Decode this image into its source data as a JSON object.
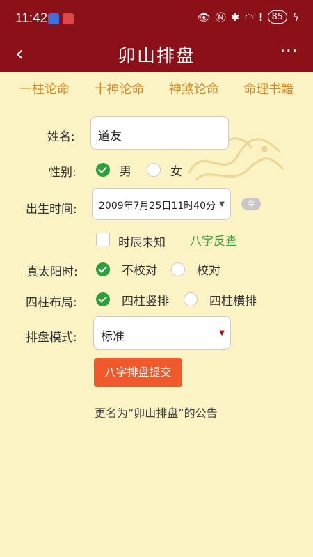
{
  "status": {
    "time": "11:42",
    "battery": "85"
  },
  "app": {
    "title": "卯山排盘"
  },
  "tabs": [
    "一柱论命",
    "十神论命",
    "神煞论命",
    "命理书籍"
  ],
  "form": {
    "name_label": "姓名:",
    "name_value": "道友",
    "gender_label": "性别:",
    "gender_male": "男",
    "gender_female": "女",
    "birth_label": "出生时间:",
    "birth_value": "2009年7月25日11时40分",
    "today_button": "今",
    "unknown_hour": "时辰未知",
    "bazi_lookup": "八字反查",
    "solar_label": "真太阳时:",
    "solar_off": "不校对",
    "solar_on": "校对",
    "layout_label": "四柱布局:",
    "layout_vertical": "四柱竖排",
    "layout_horizontal": "四柱横排",
    "mode_label": "排盘模式:",
    "mode_value": "标准",
    "submit": "八字排盘提交",
    "notice": "更名为“卯山排盘”的公告"
  }
}
